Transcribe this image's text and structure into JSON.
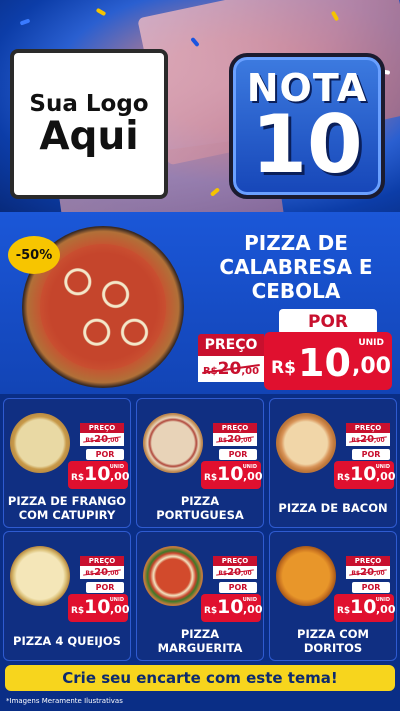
{
  "logo": {
    "line1": "Sua Logo",
    "line2": "Aqui"
  },
  "badge": {
    "line1": "NOTA",
    "line2": "10"
  },
  "featured": {
    "discount": "-50%",
    "title_lines": [
      "PIZZA DE",
      "CALABRESA E",
      "CEBOLA"
    ],
    "por_label": "POR",
    "preco_label": "PREÇO",
    "old_currency": "R$",
    "old_int": "20",
    "old_dec": ",00",
    "unid_label": "UNID",
    "new_currency": "R$",
    "new_int": "10",
    "new_dec": ",00"
  },
  "products": [
    {
      "name": "PIZZA DE FRANGO COM CATUPIRY",
      "preco_label": "PREÇO",
      "old_currency": "R$",
      "old_int": "20",
      "old_dec": ",00",
      "por_label": "POR",
      "unid_label": "UNID",
      "new_currency": "R$",
      "new_int": "10",
      "new_dec": ",00"
    },
    {
      "name": "PIZZA PORTUGUESA",
      "preco_label": "PREÇO",
      "old_currency": "R$",
      "old_int": "20",
      "old_dec": ",00",
      "por_label": "POR",
      "unid_label": "UNID",
      "new_currency": "R$",
      "new_int": "10",
      "new_dec": ",00"
    },
    {
      "name": "PIZZA DE BACON",
      "preco_label": "PREÇO",
      "old_currency": "R$",
      "old_int": "20",
      "old_dec": ",00",
      "por_label": "POR",
      "unid_label": "UNID",
      "new_currency": "R$",
      "new_int": "10",
      "new_dec": ",00"
    },
    {
      "name": "PIZZA 4 QUEIJOS",
      "preco_label": "PREÇO",
      "old_currency": "R$",
      "old_int": "20",
      "old_dec": ",00",
      "por_label": "POR",
      "unid_label": "UNID",
      "new_currency": "R$",
      "new_int": "10",
      "new_dec": ",00"
    },
    {
      "name": "PIZZA MARGUERITA",
      "preco_label": "PREÇO",
      "old_currency": "R$",
      "old_int": "20",
      "old_dec": ",00",
      "por_label": "POR",
      "unid_label": "UNID",
      "new_currency": "R$",
      "new_int": "10",
      "new_dec": ",00"
    },
    {
      "name": "PIZZA COM DORITOS",
      "preco_label": "PREÇO",
      "old_currency": "R$",
      "old_int": "20",
      "old_dec": ",00",
      "por_label": "POR",
      "unid_label": "UNID",
      "new_currency": "R$",
      "new_int": "10",
      "new_dec": ",00"
    }
  ],
  "cta": "Crie seu encarte com este tema!",
  "disclaimer": "*Imagens Meramente Ilustrativas",
  "colors": {
    "brand_blue": "#1b57d8",
    "price_red": "#e0102f",
    "cta_yellow": "#f7d51d"
  }
}
